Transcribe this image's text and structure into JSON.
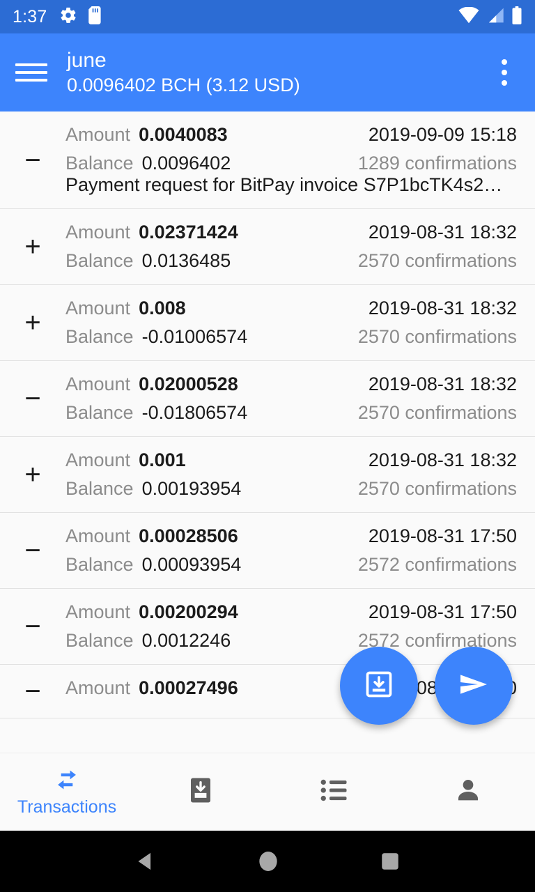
{
  "status_bar": {
    "clock": "1:37",
    "icons": [
      "gear-icon",
      "sd-card-icon"
    ],
    "right_icons": [
      "wifi-icon",
      "cell-signal-icon",
      "battery-icon"
    ],
    "background": "#2C6CD4"
  },
  "app_bar": {
    "menu_icon": "hamburger-menu-icon",
    "wallet_name": "june",
    "wallet_balance": "0.0096402 BCH (3.12 USD)",
    "overflow_icon": "overflow-menu-icon",
    "background": "#3D84FC"
  },
  "labels": {
    "amount": "Amount",
    "balance": "Balance",
    "confirmations_suffix": "confirmations"
  },
  "transactions": [
    {
      "sign": "−",
      "amount": "0.0040083",
      "balance": "0.0096402",
      "date": "2019-09-09 15:18",
      "confirmations": "1289 confirmations",
      "memo": "Payment request for BitPay invoice S7P1bcTK4s2…"
    },
    {
      "sign": "+",
      "amount": "0.02371424",
      "balance": "0.0136485",
      "date": "2019-08-31 18:32",
      "confirmations": "2570 confirmations",
      "memo": ""
    },
    {
      "sign": "+",
      "amount": "0.008",
      "balance": "-0.01006574",
      "date": "2019-08-31 18:32",
      "confirmations": "2570 confirmations",
      "memo": ""
    },
    {
      "sign": "−",
      "amount": "0.02000528",
      "balance": "-0.01806574",
      "date": "2019-08-31 18:32",
      "confirmations": "2570 confirmations",
      "memo": ""
    },
    {
      "sign": "+",
      "amount": "0.001",
      "balance": "0.00193954",
      "date": "2019-08-31 18:32",
      "confirmations": "2570 confirmations",
      "memo": ""
    },
    {
      "sign": "−",
      "amount": "0.00028506",
      "balance": "0.00093954",
      "date": "2019-08-31 17:50",
      "confirmations": "2572 confirmations",
      "memo": ""
    },
    {
      "sign": "−",
      "amount": "0.00200294",
      "balance": "0.0012246",
      "date": "2019-08-31 17:50",
      "confirmations": "2572 confirmations",
      "memo": ""
    },
    {
      "sign": "−",
      "amount": "0.00027496",
      "balance": "",
      "date": "2019-08-31 17:50",
      "confirmations": "",
      "memo": ""
    }
  ],
  "fabs": {
    "receive": {
      "icon": "receive-inbox-download-icon"
    },
    "send": {
      "icon": "send-paper-plane-icon"
    },
    "color": "#3D84FC"
  },
  "bottom_nav": {
    "active_color": "#3D84FC",
    "inactive_color": "#5F5F5F",
    "items": [
      {
        "icon": "transactions-exchange-arrows-icon",
        "label": "Transactions",
        "active": true
      },
      {
        "icon": "receive-inbox-download-icon",
        "label": "",
        "active": false
      },
      {
        "icon": "bulleted-list-icon",
        "label": "",
        "active": false
      },
      {
        "icon": "person-contacts-icon",
        "label": "",
        "active": false
      }
    ]
  },
  "android_nav": {
    "back": "back-triangle-icon",
    "home": "home-circle-icon",
    "recents": "recents-square-icon"
  }
}
